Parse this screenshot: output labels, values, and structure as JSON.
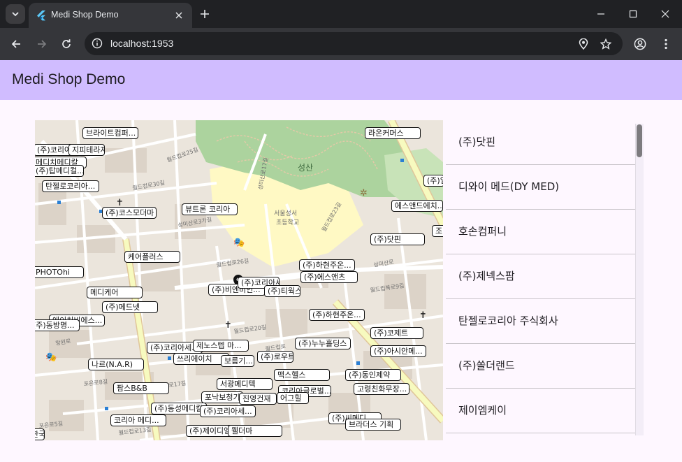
{
  "browser": {
    "tab_title": "Medi Shop Demo",
    "url": "localhost:1953"
  },
  "app": {
    "title": "Medi Shop Demo"
  },
  "map": {
    "place_labels": [
      "성산",
      "서울성서\n초등학교"
    ],
    "street_labels": [
      "월드컵로25길",
      "월드컵로23길",
      "성미산로17길",
      "월드컵북로9길",
      "월드컵로17길",
      "월드컵로13길",
      "망원로",
      "포은로",
      "포은로8길",
      "포은로5길",
      "월드컵로30길",
      "월드컵로26길",
      "월드컵로20길",
      "성미산로",
      "성미산로3가길",
      "월드컵로"
    ],
    "markers": [
      {
        "label": "브라이트컴퍼..."
      },
      {
        "label": "라온커머스"
      },
      {
        "label": "(주)코리아세..."
      },
      {
        "label": "지피테라자"
      },
      {
        "label": "메디치메디칼"
      },
      {
        "label": "(주)탑메디컬..."
      },
      {
        "label": "탄젤로코리아..."
      },
      {
        "label": "(주)코스모더마"
      },
      {
        "label": "뷰트론 코리아"
      },
      {
        "label": "(주)닷핀"
      },
      {
        "label": "에스앤드에치..."
      },
      {
        "label": "(주)일..."
      },
      {
        "label": "조..."
      },
      {
        "label": "케어플러스"
      },
      {
        "label": "(주)하현주온..."
      },
      {
        "label": "(주)에스앤츠"
      },
      {
        "label": "PHOTOhi"
      },
      {
        "label": "메디케어"
      },
      {
        "label": "(주)비엔비인..."
      },
      {
        "label": "(주)코리아세..."
      },
      {
        "label": "(주)티웍스..."
      },
      {
        "label": "(주)메드넷"
      },
      {
        "label": "(주)하현주온..."
      },
      {
        "label": "에이치비에스..."
      },
      {
        "label": "(주)동방명..."
      },
      {
        "label": "(주)코제트"
      },
      {
        "label": "(주)누누홀딩스"
      },
      {
        "label": "(주)아시안메..."
      },
      {
        "label": "(주)코리아세..."
      },
      {
        "label": "제노스텝 마..."
      },
      {
        "label": "쓰리에이치"
      },
      {
        "label": "보름기..."
      },
      {
        "label": "(주)로우트립..."
      },
      {
        "label": "나르(N.A.R)"
      },
      {
        "label": "맥스헬스"
      },
      {
        "label": "(주)동인제약"
      },
      {
        "label": "서광메디텍"
      },
      {
        "label": "팜스B&B"
      },
      {
        "label": "고령친화무장..."
      },
      {
        "label": "코리아글로벌..."
      },
      {
        "label": "포낙보청기"
      },
      {
        "label": "진영건재"
      },
      {
        "label": "어그힐"
      },
      {
        "label": "(주)동성메디칼"
      },
      {
        "label": "(주)코리아세..."
      },
      {
        "label": "코리아 메디..."
      },
      {
        "label": "(주)씨메디..."
      },
      {
        "label": "브라더스 기획"
      },
      {
        "label": "(주)제이디엠"
      },
      {
        "label": "웰더마"
      },
      {
        "label": "한국도..."
      }
    ]
  },
  "list": {
    "items": [
      {
        "label": "(주)닷핀"
      },
      {
        "label": "디와이 메드(DY MED)"
      },
      {
        "label": "호손컴퍼니"
      },
      {
        "label": "(주)제넥스팜"
      },
      {
        "label": "탄젤로코리아 주식회사"
      },
      {
        "label": "(주)쏠더랜드"
      },
      {
        "label": "제이엠케이"
      }
    ]
  },
  "colors": {
    "appbar": "#d0bcff",
    "surface": "#fef7ff",
    "park": "#acd39e",
    "road_major": "#f7fabf",
    "road_major_border": "#e0c69a"
  }
}
